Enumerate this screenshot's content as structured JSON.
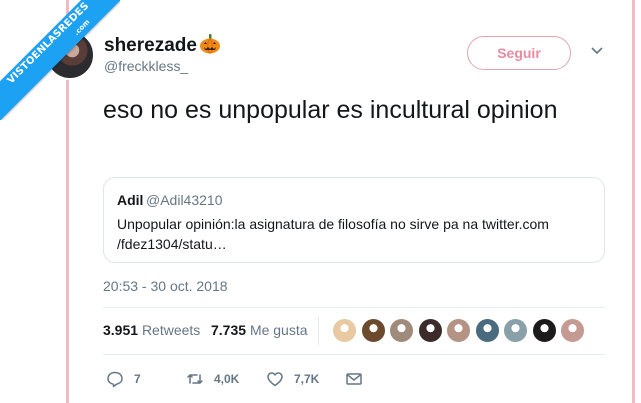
{
  "watermark": {
    "main": "VISTOENLASREDES",
    "sub": ".com"
  },
  "author": {
    "display_name": "sherezade",
    "handle": "@freckkless_"
  },
  "follow_button": "Seguir",
  "tweet": {
    "text": "eso no es unpopular es incultural opinion",
    "timestamp": "20:53 - 30 oct. 2018"
  },
  "quoted_tweet": {
    "name": "Adil",
    "handle": "@Adil43210",
    "text": "Unpopular opinión:la asignatura de filosofía no sirve pa na twitter.com /fdez1304/statu…"
  },
  "stats": {
    "retweets_count": "3.951",
    "retweets_label": "Retweets",
    "likes_count": "7.735",
    "likes_label": "Me gusta"
  },
  "likers": [
    {
      "color": "#e8c9a2"
    },
    {
      "color": "#6b4a2e"
    },
    {
      "color": "#a08a7c"
    },
    {
      "color": "#3b2b2a"
    },
    {
      "color": "#b59384"
    },
    {
      "color": "#4a6a7e"
    },
    {
      "color": "#8aa0a8"
    },
    {
      "color": "#1d1a1c"
    },
    {
      "color": "#c49a93"
    }
  ],
  "actions": {
    "replies": "7",
    "retweets": "4,0K",
    "likes": "7,7K"
  },
  "colors": {
    "accent": "#1da1f2",
    "follow": "#e98aa0",
    "muted": "#657786",
    "frame": "#f5b9c3"
  }
}
